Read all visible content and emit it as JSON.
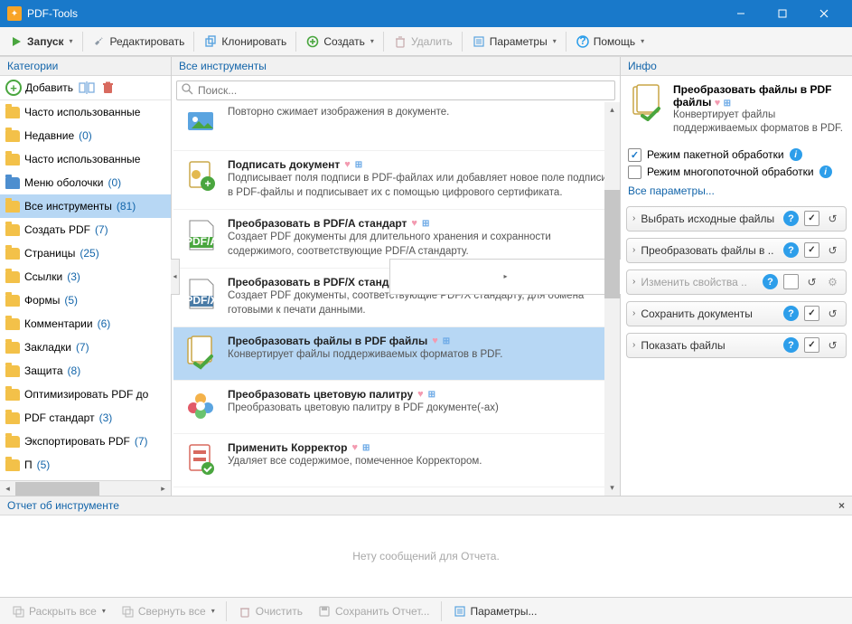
{
  "window": {
    "title": "PDF-Tools"
  },
  "toolbar": {
    "run": "Запуск",
    "edit": "Редактировать",
    "clone": "Клонировать",
    "create": "Создать",
    "delete": "Удалить",
    "params": "Параметры",
    "help": "Помощь"
  },
  "left": {
    "header": "Категории",
    "add": "Добавить"
  },
  "categories": [
    {
      "label": "Часто использованные",
      "count": "",
      "folder": "yellow"
    },
    {
      "label": "Недавние",
      "count": "(0)",
      "folder": "yellow"
    },
    {
      "label": "Часто использованные",
      "count": "",
      "folder": "yellow"
    },
    {
      "label": "Меню оболочки",
      "count": "(0)",
      "folder": "blue"
    },
    {
      "label": "Все инструменты",
      "count": "(81)",
      "folder": "yellow",
      "selected": true
    },
    {
      "label": "Создать PDF",
      "count": "(7)",
      "folder": "yellow"
    },
    {
      "label": "Страницы",
      "count": "(25)",
      "folder": "yellow"
    },
    {
      "label": "Ссылки",
      "count": "(3)",
      "folder": "yellow"
    },
    {
      "label": "Формы",
      "count": "(5)",
      "folder": "yellow"
    },
    {
      "label": "Комментарии",
      "count": "(6)",
      "folder": "yellow"
    },
    {
      "label": "Закладки",
      "count": "(7)",
      "folder": "yellow"
    },
    {
      "label": "Защита",
      "count": "(8)",
      "folder": "yellow"
    },
    {
      "label": "Оптимизировать PDF до",
      "count": "",
      "folder": "yellow"
    },
    {
      "label": "PDF стандарт",
      "count": "(3)",
      "folder": "yellow"
    },
    {
      "label": "Экспортировать PDF",
      "count": "(7)",
      "folder": "yellow"
    },
    {
      "label": "П",
      "count": "(5)",
      "folder": "yellow"
    }
  ],
  "center": {
    "header": "Все инструменты",
    "search_placeholder": "Поиск..."
  },
  "tools": [
    {
      "name": "",
      "desc": "Повторно сжимает изображения в документе.",
      "partial": true
    },
    {
      "name": "Подписать документ",
      "desc": "Подписывает поля подписи в PDF-файлах или добавляет новое поле подписи в PDF-файлы и подписывает их с помощью цифрового сертификата."
    },
    {
      "name": "Преобразовать в PDF/A стандарт",
      "desc": "Создает PDF документы для длительного хранения и сохранности содержимого, соответствующие PDF/A стандарту."
    },
    {
      "name": "Преобразовать в PDF/X стандарт",
      "desc": "Создает PDF документы, соответствующие PDF/X стандарту, для обмена готовыми к печати данными."
    },
    {
      "name": "Преобразовать файлы в PDF файлы",
      "desc": "Конвертирует файлы поддерживаемых форматов в PDF.",
      "selected": true
    },
    {
      "name": "Преобразовать цветовую палитру",
      "desc": "Преобразовать цветовую палитру в PDF документе(-ах)"
    },
    {
      "name": "Применить Корректор",
      "desc": "Удаляет все содержимое, помеченное Корректором."
    }
  ],
  "info": {
    "header": "Инфо",
    "sel_name": "Преобразовать файлы в PDF файлы",
    "sel_desc": "Конвертирует файлы поддерживаемых форматов в PDF.",
    "batch": "Режим пакетной обработки",
    "mt": "Режим многопоточной обработки",
    "all_params": "Все параметры..."
  },
  "steps": [
    {
      "label": "Выбрать исходные файлы",
      "checked": true
    },
    {
      "label": "Преобразовать файлы в ..",
      "checked": true
    },
    {
      "label": "Изменить свойства ..",
      "checked": false,
      "faded": true,
      "gear": true
    },
    {
      "label": "Сохранить документы",
      "checked": true
    },
    {
      "label": "Показать файлы",
      "checked": true
    }
  ],
  "report": {
    "header": "Отчет об инструменте",
    "empty": "Нету сообщений для Отчета."
  },
  "bottom": {
    "expand_all": "Раскрыть все",
    "collapse_all": "Свернуть все",
    "clear": "Очистить",
    "save_report": "Сохранить Отчет...",
    "params": "Параметры..."
  }
}
